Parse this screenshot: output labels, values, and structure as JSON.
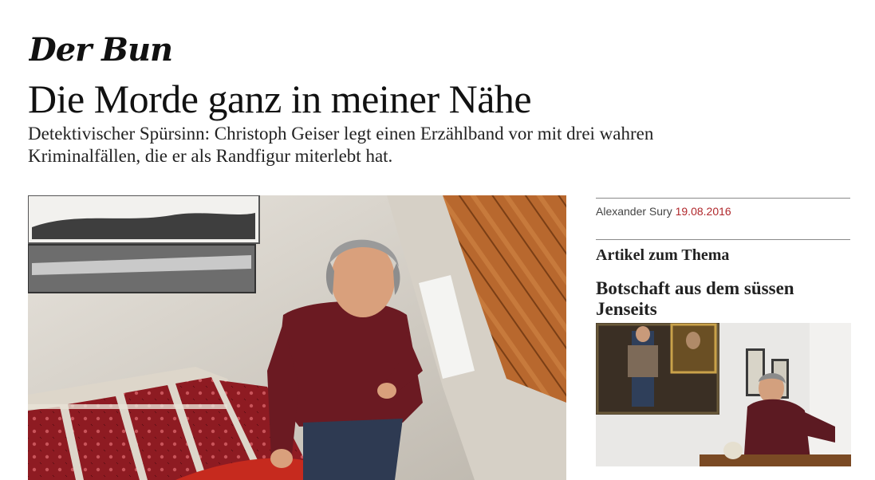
{
  "masthead": {
    "logo_text": "Der Bund"
  },
  "article": {
    "headline": "Die Morde ganz in meiner Nähe",
    "lead": "Detektivischer Spürsinn: Christoph Geiser legt einen Erzählband vor mit drei wahren Kriminalfällen, die er als Randfigur miterlebt hat.",
    "author": "Alexander Sury",
    "date": "19.08.2016"
  },
  "related": {
    "heading": "Artikel zum Thema",
    "items": [
      {
        "title": "Botschaft aus dem süssen Jenseits"
      }
    ]
  },
  "colors": {
    "date_accent": "#b0272b",
    "text": "#111111",
    "rule": "#8a8a8a",
    "carpet_red": "#8e1b22",
    "sweater": "#6b1a22"
  }
}
